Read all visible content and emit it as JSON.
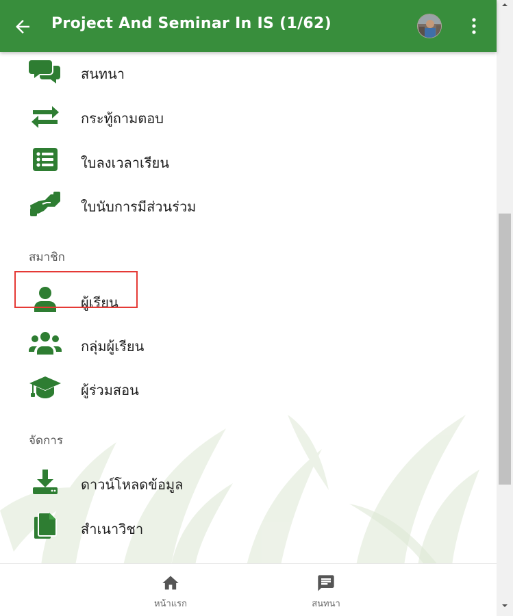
{
  "colors": {
    "primary": "#388e3c",
    "icon_green": "#2e7d32",
    "highlight": "#e53935"
  },
  "appbar": {
    "title": "Project And Seminar In IS (1/62)",
    "back_icon": "arrow-left-icon",
    "more_icon": "more-vertical-icon"
  },
  "menu": {
    "items_top": [
      {
        "label": "สนทนา",
        "icon": "chat-bubbles-icon"
      },
      {
        "label": "กระทู้ถามตอบ",
        "icon": "swap-arrows-icon"
      },
      {
        "label": "ใบลงเวลาเรียน",
        "icon": "list-icon"
      },
      {
        "label": "ใบนับการมีส่วนร่วม",
        "icon": "handshake-icon"
      }
    ],
    "section_members": "สมาชิก",
    "items_members": [
      {
        "label": "ผู้เรียน",
        "icon": "person-icon"
      },
      {
        "label": "กลุ่มผู้เรียน",
        "icon": "group-icon"
      },
      {
        "label": "ผู้ร่วมสอน",
        "icon": "graduation-cap-icon"
      }
    ],
    "section_manage": "จัดการ",
    "items_manage": [
      {
        "label": "ดาวน์โหลดข้อมูล",
        "icon": "download-icon"
      },
      {
        "label": "สำเนาวิชา",
        "icon": "copy-icon"
      }
    ]
  },
  "bottom_nav": [
    {
      "label": "หน้าแรก",
      "icon": "home-icon"
    },
    {
      "label": "สนทนา",
      "icon": "chat-icon"
    }
  ]
}
